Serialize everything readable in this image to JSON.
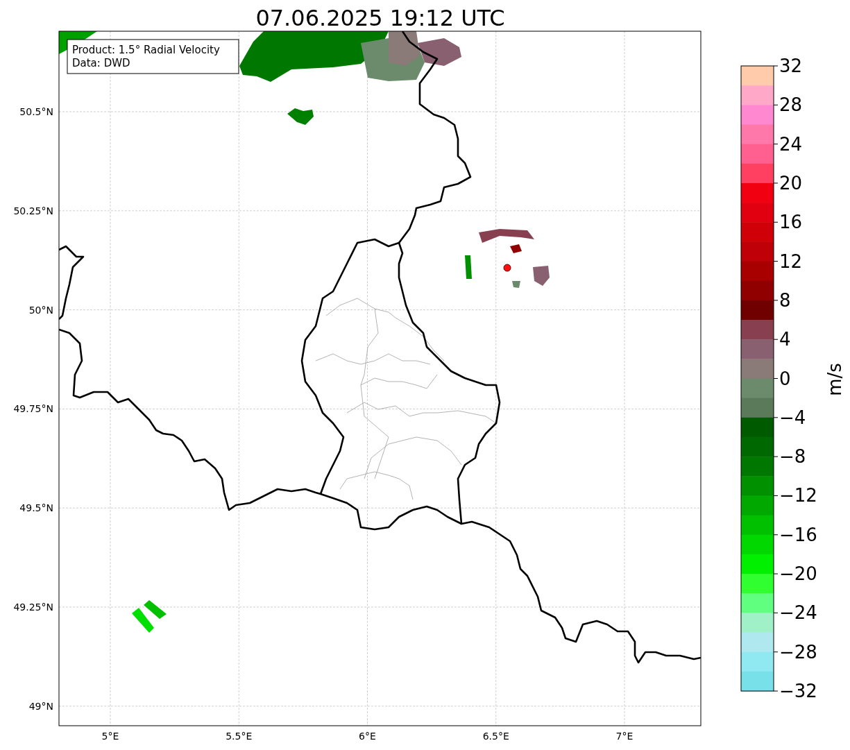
{
  "title": "07.06.2025 19:12 UTC",
  "legend": {
    "lines": [
      "Product: 1.5° Radial Velocity",
      "Data: DWD"
    ]
  },
  "map": {
    "latitude_ticks": [
      "50.5°N",
      "50.25°N",
      "50°N",
      "49.75°N",
      "49.5°N",
      "49.25°N",
      "49°N"
    ],
    "longitude_ticks": [
      "5°E",
      "5.5°E",
      "6°E",
      "6.5°E",
      "7°E"
    ]
  },
  "colorbar": {
    "label": "m/s",
    "ticks": [
      "32",
      "28",
      "24",
      "20",
      "16",
      "12",
      "8",
      "4",
      "0",
      "−4",
      "−8",
      "−12",
      "−16",
      "−20",
      "−24",
      "−28",
      "−32"
    ],
    "segments": [
      {
        "color": "#ffcbaa"
      },
      {
        "color": "#ffa8c8"
      },
      {
        "color": "#ff88d0"
      },
      {
        "color": "#ff78aa"
      },
      {
        "color": "#ff6090"
      },
      {
        "color": "#ff4060"
      },
      {
        "color": "#f00010"
      },
      {
        "color": "#e00010"
      },
      {
        "color": "#d00008"
      },
      {
        "color": "#c00008"
      },
      {
        "color": "#a80000"
      },
      {
        "color": "#900000"
      },
      {
        "color": "#700000"
      },
      {
        "color": "#884050"
      },
      {
        "color": "#886070"
      },
      {
        "color": "#8a7a78"
      },
      {
        "color": "#6c8a6c"
      },
      {
        "color": "#5a7a5a"
      },
      {
        "color": "#005a00"
      },
      {
        "color": "#006800"
      },
      {
        "color": "#007800"
      },
      {
        "color": "#009000"
      },
      {
        "color": "#00a800"
      },
      {
        "color": "#00c000"
      },
      {
        "color": "#00d800"
      },
      {
        "color": "#00f000"
      },
      {
        "color": "#30ff30"
      },
      {
        "color": "#60ff80"
      },
      {
        "color": "#a0f0c8"
      },
      {
        "color": "#b0e8f0"
      },
      {
        "color": "#90e8f0"
      },
      {
        "color": "#78e0e8"
      }
    ]
  }
}
